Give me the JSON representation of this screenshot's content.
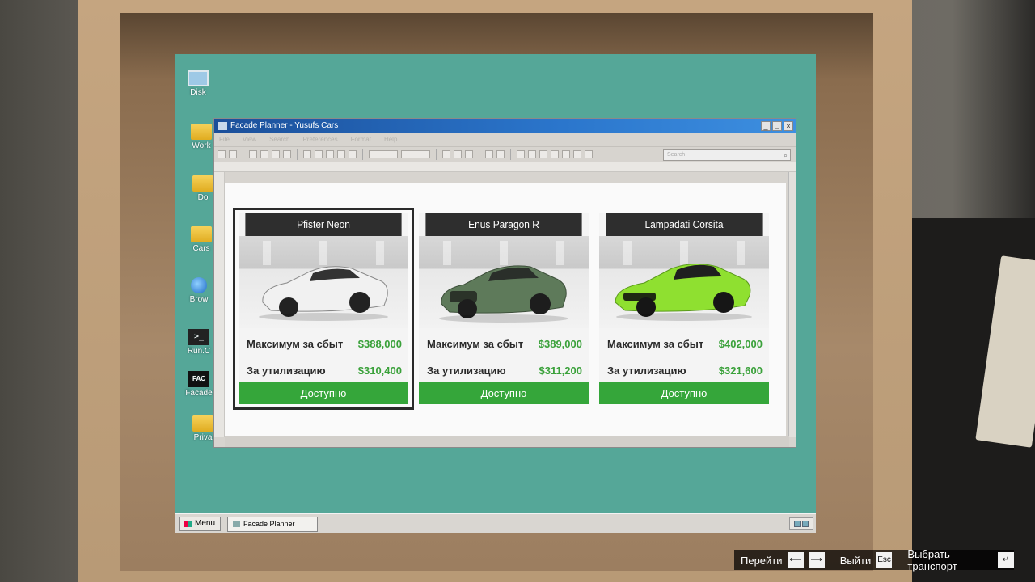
{
  "desktop": {
    "icons": [
      {
        "label": "Disk",
        "icon": "computer-icon"
      },
      {
        "label": "Work",
        "icon": "folder-icon"
      },
      {
        "label": "Do",
        "icon": "folder-icon"
      },
      {
        "label": "Cars",
        "icon": "folder-icon"
      },
      {
        "label": "Brow",
        "icon": "globe-icon"
      },
      {
        "label": "Run.C",
        "icon": "terminal-icon"
      },
      {
        "label": "Facade",
        "icon": "facade-icon"
      },
      {
        "label": "Priva",
        "icon": "folder-icon"
      }
    ],
    "terminal_glyph": ">_",
    "facade_glyph": "FAC"
  },
  "window": {
    "title": "Facade Planner - Yusufs Cars",
    "menu": [
      "File",
      "View",
      "Search",
      "Preferences",
      "Format",
      "Help"
    ],
    "search_placeholder": "Search",
    "minimize": "_",
    "maximize": "□",
    "close": "×"
  },
  "cards": [
    {
      "name": "Pfister Neon",
      "sell_label": "Максимум за сбыт",
      "sell_value": "$388,000",
      "scrap_label": "За утилизацию",
      "scrap_value": "$310,400",
      "button": "Доступно",
      "car_color": "#f1f1f1",
      "selected": true
    },
    {
      "name": "Enus Paragon R",
      "sell_label": "Максимум за сбыт",
      "sell_value": "$389,000",
      "scrap_label": "За утилизацию",
      "scrap_value": "$311,200",
      "button": "Доступно",
      "car_color": "#5e7a5a",
      "selected": false
    },
    {
      "name": "Lampadati Corsita",
      "sell_label": "Максимум за сбыт",
      "sell_value": "$402,000",
      "scrap_label": "За утилизацию",
      "scrap_value": "$321,600",
      "button": "Доступно",
      "car_color": "#8fe030",
      "selected": false
    }
  ],
  "taskbar": {
    "menu_label": "Menu",
    "task_label": "Facade Planner"
  },
  "hints": {
    "navigate_label": "Перейти",
    "navigate_key_left": "⟵",
    "navigate_key_right": "⟶",
    "exit_label": "Выйти",
    "exit_key": "Esc",
    "select_label": "Выбрать транспорт",
    "select_key": "↵"
  },
  "colors": {
    "accent_green": "#3aa13a",
    "button_green": "#35a63a",
    "desktop_teal": "#55a798",
    "titlebar_blue": "#2b76cc"
  }
}
